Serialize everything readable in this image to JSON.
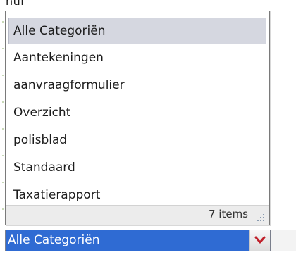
{
  "background_text": "nul",
  "dropdown": {
    "items": [
      {
        "label": "Alle Categoriën",
        "selected": true
      },
      {
        "label": "Aantekeningen",
        "selected": false
      },
      {
        "label": "aanvraagformulier",
        "selected": false
      },
      {
        "label": "Overzicht",
        "selected": false
      },
      {
        "label": "polisblad",
        "selected": false
      },
      {
        "label": "Standaard",
        "selected": false
      },
      {
        "label": "Taxatierapport",
        "selected": false
      }
    ],
    "status_count": "7 items"
  },
  "combo": {
    "value": "Alle Categoriën",
    "button_icon": "chevron-down-icon",
    "accent_color": "#2f6bd3",
    "chevron_color": "#c0202a"
  }
}
